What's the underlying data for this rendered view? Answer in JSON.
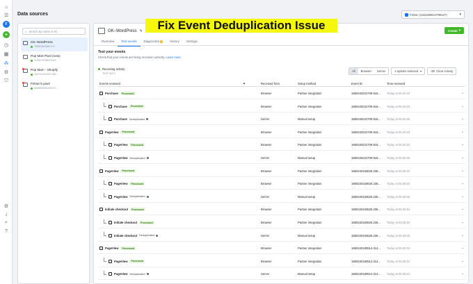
{
  "header": {
    "title": "Data sources",
    "banner": "Fix Event Deduplication Issue",
    "account_name": "Fshion (1316269613796107)"
  },
  "rail": {
    "avatar_letter": "F",
    "plus_symbol": "+"
  },
  "sources": {
    "search_placeholder": "Search by name or ID",
    "items": [
      {
        "name": "GK–WordPress",
        "id": "796524625887474"
      },
      {
        "name": "Pop Mart Pixel (new)",
        "id": "1185170186075392"
      },
      {
        "name": "Pop Mart – Shopify",
        "id": "2227013419917382"
      },
      {
        "name": "Fshion's pixel",
        "id": "8445818281091971"
      }
    ]
  },
  "main": {
    "pixel_name": "GK–WordPress",
    "create_label": "Create",
    "tabs": [
      {
        "label": "Overview"
      },
      {
        "label": "Test events"
      },
      {
        "label": "Diagnostics",
        "badge": "1"
      },
      {
        "label": "History"
      },
      {
        "label": "Settings"
      }
    ],
    "section_title": "Test your events",
    "section_sub": "Check that your events are being received correctly.",
    "learn_more": "Learn more",
    "activity_label": "Receiving activity",
    "activity_id": "TEST78479",
    "filters": {
      "all": "All",
      "browser": "Browser",
      "server": "Server",
      "options": "4 options selected",
      "clear": "Clear Activity"
    }
  },
  "table": {
    "columns": [
      "Events received",
      "Received from",
      "Setup method",
      "Event ID",
      "Time received"
    ],
    "rows": [
      {
        "event": "Purchase",
        "level": 0,
        "status": "Processed",
        "from": "Browser",
        "method": "Partner integration",
        "eid": "1660240222709.918...",
        "time": "Today at 05:40:23"
      },
      {
        "event": "Purchase",
        "level": 1,
        "status": "Processed",
        "from": "Browser",
        "method": "Partner integration",
        "eid": "1660240222709.918...",
        "time": "Today at 05:40:23"
      },
      {
        "event": "Purchase",
        "level": 1,
        "status": "Deduplicated",
        "from": "Server",
        "method": "Manual setup",
        "eid": "1660240222709.918...",
        "time": "Today at 05:40:25"
      },
      {
        "event": "PageView",
        "level": 0,
        "status": "Processed",
        "from": "Browser",
        "method": "Partner integration",
        "eid": "1660240222709.918...",
        "time": "Today at 05:40:23"
      },
      {
        "event": "PageView",
        "level": 1,
        "status": "Processed",
        "from": "Browser",
        "method": "Partner integration",
        "eid": "1660240222709.918...",
        "time": "Today at 05:40:23"
      },
      {
        "event": "PageView",
        "level": 1,
        "status": "Deduplicated",
        "from": "Server",
        "method": "Manual setup",
        "eid": "1660240222709.918...",
        "time": "Today at 05:40:26"
      },
      {
        "event": "PageView",
        "level": 0,
        "status": "Processed",
        "from": "Browser",
        "method": "Partner integration",
        "eid": "1660240163626.236...",
        "time": "Today at 05:39:24"
      },
      {
        "event": "PageView",
        "level": 1,
        "status": "Processed",
        "from": "Browser",
        "method": "Partner integration",
        "eid": "1660240163626.236...",
        "time": "Today at 05:39:24"
      },
      {
        "event": "PageView",
        "level": 1,
        "status": "Deduplicated",
        "from": "Server",
        "method": "Manual setup",
        "eid": "1660240163626.236...",
        "time": "Today at 05:39:26"
      },
      {
        "event": "Initiate checkout",
        "level": 0,
        "status": "Processed",
        "from": "Browser",
        "method": "Partner integration",
        "eid": "1660240163626.236...",
        "time": "Today at 05:39:24"
      },
      {
        "event": "Initiate checkout",
        "level": 1,
        "status": "Processed",
        "from": "Browser",
        "method": "Partner integration",
        "eid": "1660240163626.236...",
        "time": "Today at 05:39:24"
      },
      {
        "event": "Initiate checkout",
        "level": 1,
        "status": "Deduplicated",
        "from": "Server",
        "method": "Manual setup",
        "eid": "1660240163626.236...",
        "time": "Today at 05:39:25"
      },
      {
        "event": "PageView",
        "level": 0,
        "status": "Processed",
        "from": "Browser",
        "method": "Partner integration",
        "eid": "1660240180514.314...",
        "time": "Today at 05:39:10"
      },
      {
        "event": "PageView",
        "level": 1,
        "status": "Processed",
        "from": "Browser",
        "method": "Partner integration",
        "eid": "1660240180514.314...",
        "time": "Today at 05:39:10"
      },
      {
        "event": "PageView",
        "level": 1,
        "status": "Deduplicated",
        "from": "Server",
        "method": "Manual setup",
        "eid": "1660240180514.314...",
        "time": "Today at 05:39:13"
      }
    ]
  },
  "colors": {
    "accent": "#1877f2",
    "success": "#42b72a",
    "banner": "#f5f80a"
  }
}
